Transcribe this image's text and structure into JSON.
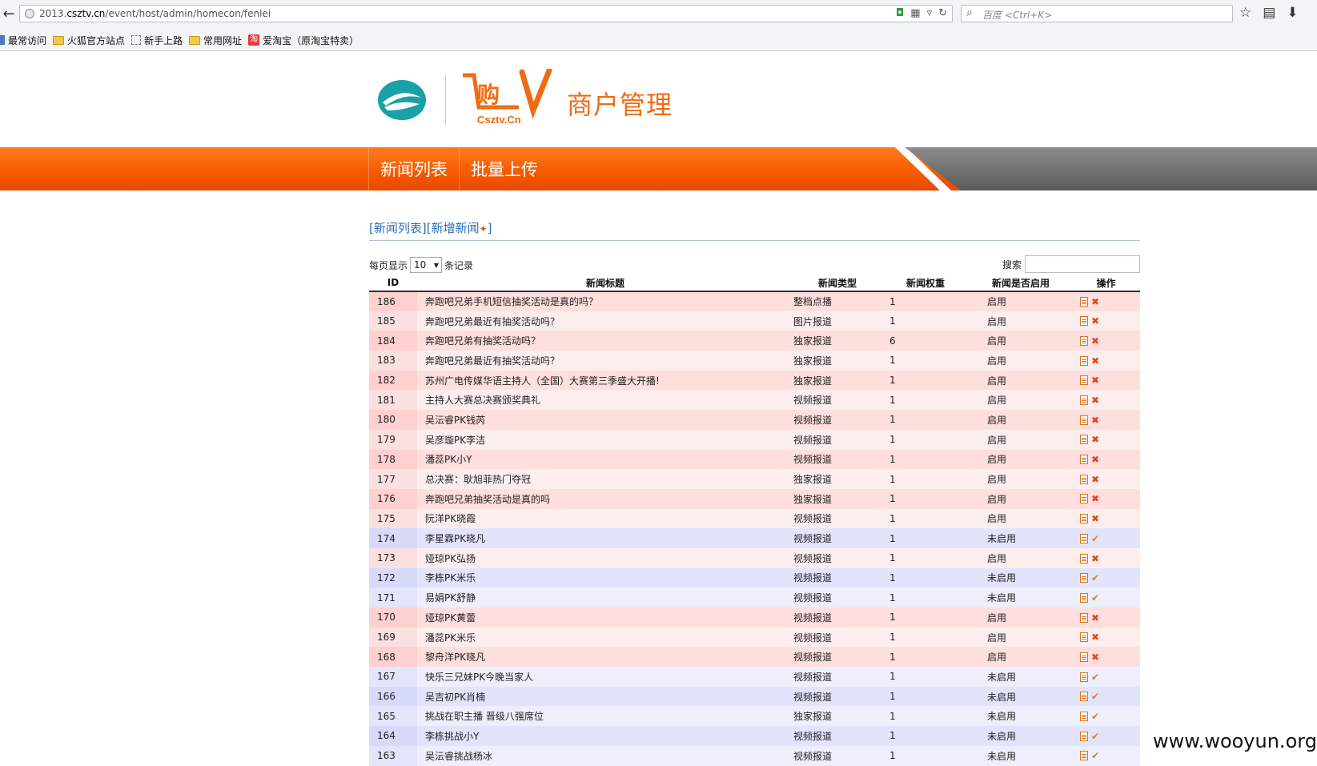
{
  "browser": {
    "url_prefix": "2013.",
    "url_domain": "csztv.cn",
    "url_path": "/event/host/admin/homecon/fenlei",
    "search_placeholder": "百度 <Ctrl+K>",
    "bookmarks": [
      {
        "label": "最常访问",
        "icon": "star-icon"
      },
      {
        "label": "火狐官方站点",
        "icon": "folder-icon"
      },
      {
        "label": "新手上路",
        "icon": "dotted-box-icon"
      },
      {
        "label": "常用网址",
        "icon": "folder-icon"
      },
      {
        "label": "爱淘宝（原淘宝特卖）",
        "icon": "taobao-icon"
      }
    ]
  },
  "header": {
    "brand_sub": "Csztv.Cn",
    "title": "商户管理"
  },
  "nav": {
    "items": [
      "新闻列表",
      "批量上传"
    ],
    "accent": "#f55a00"
  },
  "crumbs": {
    "list": "[新闻列表]",
    "add": "[新增新闻",
    "add_close": "]"
  },
  "controls": {
    "per_page_label": "每页显示",
    "per_page_value": "10",
    "records_label": "条记录",
    "search_label": "搜索"
  },
  "table": {
    "headers": [
      "ID",
      "新闻标题",
      "新闻类型",
      "新闻权重",
      "新闻是否启用",
      "操作"
    ],
    "rows": [
      {
        "id": "186",
        "title": "奔跑吧兄弟手机短信抽奖活动是真的吗？",
        "type": "整档点播",
        "weight": "1",
        "enabled": "启用",
        "action": "x"
      },
      {
        "id": "185",
        "title": "奔跑吧兄弟最近有抽奖活动吗？",
        "type": "图片报道",
        "weight": "1",
        "enabled": "启用",
        "action": "x"
      },
      {
        "id": "184",
        "title": "奔跑吧兄弟有抽奖活动吗？",
        "type": "独家报道",
        "weight": "6",
        "enabled": "启用",
        "action": "x"
      },
      {
        "id": "183",
        "title": "奔跑吧兄弟最近有抽奖活动吗？",
        "type": "独家报道",
        "weight": "1",
        "enabled": "启用",
        "action": "x"
      },
      {
        "id": "182",
        "title": "苏州广电传媒华语主持人（全国）大赛第三季盛大开播!",
        "type": "独家报道",
        "weight": "1",
        "enabled": "启用",
        "action": "x"
      },
      {
        "id": "181",
        "title": "主持人大赛总决赛颁奖典礼",
        "type": "视频报道",
        "weight": "1",
        "enabled": "启用",
        "action": "x"
      },
      {
        "id": "180",
        "title": "吴沄睿PK钱芮",
        "type": "视频报道",
        "weight": "1",
        "enabled": "启用",
        "action": "x"
      },
      {
        "id": "179",
        "title": "吴彦璇PK李洁",
        "type": "视频报道",
        "weight": "1",
        "enabled": "启用",
        "action": "x"
      },
      {
        "id": "178",
        "title": "潘蕊PK小Y",
        "type": "视频报道",
        "weight": "1",
        "enabled": "启用",
        "action": "x"
      },
      {
        "id": "177",
        "title": "总决赛：耿旭菲热门夺冠",
        "type": "独家报道",
        "weight": "1",
        "enabled": "启用",
        "action": "x"
      },
      {
        "id": "176",
        "title": "奔跑吧兄弟抽奖活动是真的吗",
        "type": "独家报道",
        "weight": "1",
        "enabled": "启用",
        "action": "x"
      },
      {
        "id": "175",
        "title": "阮洋PK晓霞",
        "type": "视频报道",
        "weight": "1",
        "enabled": "启用",
        "action": "x"
      },
      {
        "id": "174",
        "title": "李星霖PK晓凡",
        "type": "视频报道",
        "weight": "1",
        "enabled": "未启用",
        "action": "check"
      },
      {
        "id": "173",
        "title": "娅琼PK弘扬",
        "type": "视频报道",
        "weight": "1",
        "enabled": "启用",
        "action": "x"
      },
      {
        "id": "172",
        "title": "李栋PK米乐",
        "type": "视频报道",
        "weight": "1",
        "enabled": "未启用",
        "action": "check"
      },
      {
        "id": "171",
        "title": "易娟PK舒静",
        "type": "视频报道",
        "weight": "1",
        "enabled": "未启用",
        "action": "check"
      },
      {
        "id": "170",
        "title": "娅琼PK黄蕾",
        "type": "视频报道",
        "weight": "1",
        "enabled": "启用",
        "action": "x"
      },
      {
        "id": "169",
        "title": "潘蕊PK米乐",
        "type": "视频报道",
        "weight": "1",
        "enabled": "启用",
        "action": "x"
      },
      {
        "id": "168",
        "title": "黎舟洋PK晓凡",
        "type": "视频报道",
        "weight": "1",
        "enabled": "启用",
        "action": "x"
      },
      {
        "id": "167",
        "title": "快乐三兄妹PK今晚当家人",
        "type": "视频报道",
        "weight": "1",
        "enabled": "未启用",
        "action": "check"
      },
      {
        "id": "166",
        "title": "吴吉初PK肖楠",
        "type": "视频报道",
        "weight": "1",
        "enabled": "未启用",
        "action": "check"
      },
      {
        "id": "165",
        "title": "挑战在职主播 晋级八强席位",
        "type": "独家报道",
        "weight": "1",
        "enabled": "未启用",
        "action": "check"
      },
      {
        "id": "164",
        "title": "李栋挑战小Y",
        "type": "视频报道",
        "weight": "1",
        "enabled": "未启用",
        "action": "check"
      },
      {
        "id": "163",
        "title": "吴沄睿挑战杨冰",
        "type": "视频报道",
        "weight": "1",
        "enabled": "未启用",
        "action": "check"
      }
    ]
  },
  "watermark": "www.wooyun.org"
}
